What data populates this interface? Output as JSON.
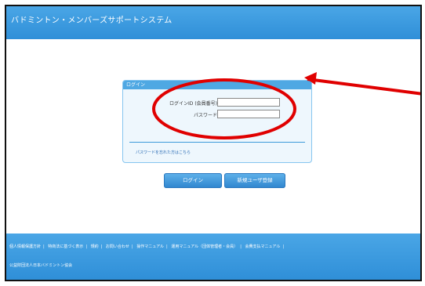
{
  "header": {
    "title": "バドミントン・メンバーズサポートシステム"
  },
  "login": {
    "box_title": "ログイン",
    "member_id_label": "ログインID (会員番号)",
    "member_id_value": "",
    "password_label": "パスワード",
    "password_value": "",
    "forgot_password": "パスワードを忘れた方はこちら"
  },
  "buttons": {
    "login": "ログイン",
    "register": "新規ユーザ登録"
  },
  "footer": {
    "links": [
      "個人情報保護方針",
      "特商法に基づく表示",
      "規約",
      "お問い合わせ",
      "操作マニュアル",
      "運用マニュアル（団体管理者・会員）",
      "会費支払マニュアル"
    ],
    "separator": "|",
    "copyright": "公益財団法人日本バドミントン協会"
  },
  "colors": {
    "brand_blue": "#3399dd",
    "annotation_red": "#e00000"
  }
}
